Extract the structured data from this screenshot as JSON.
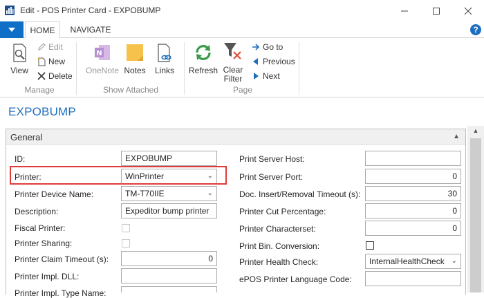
{
  "window": {
    "title": "Edit - POS Printer Card - EXPOBUMP"
  },
  "tabs": {
    "home": "HOME",
    "navigate": "NAVIGATE"
  },
  "ribbon": {
    "view": "View",
    "edit": "Edit",
    "new": "New",
    "delete": "Delete",
    "manage_group": "Manage",
    "onenote": "OneNote",
    "notes": "Notes",
    "links": "Links",
    "show_attached_group": "Show Attached",
    "refresh": "Refresh",
    "clear_filter": "Clear Filter",
    "goto": "Go to",
    "previous": "Previous",
    "next": "Next",
    "page_group": "Page"
  },
  "page": {
    "title": "EXPOBUMP",
    "section": "General"
  },
  "fields_left": {
    "id_label": "ID:",
    "id_value": "EXPOBUMP",
    "printer_label": "Printer:",
    "printer_value": "WinPrinter",
    "device_label": "Printer Device Name:",
    "device_value": "TM-T70IIE",
    "desc_label": "Description:",
    "desc_value": "Expeditor bump printer",
    "fiscal_label": "Fiscal Printer:",
    "sharing_label": "Printer Sharing:",
    "claim_label": "Printer Claim Timeout (s):",
    "claim_value": "0",
    "impl_dll_label": "Printer Impl. DLL:",
    "impl_type_label": "Printer Impl. Type Name:"
  },
  "fields_right": {
    "host_label": "Print Server Host:",
    "port_label": "Print Server Port:",
    "port_value": "0",
    "doc_timeout_label": "Doc. Insert/Removal Timeout (s):",
    "doc_timeout_value": "30",
    "cut_label": "Printer Cut Percentage:",
    "cut_value": "0",
    "charset_label": "Printer Characterset:",
    "charset_value": "0",
    "bin_label": "Print Bin. Conversion:",
    "health_label": "Printer Health Check:",
    "health_value": "InternalHealthCheck",
    "epos_label": "ePOS Printer Language Code:"
  },
  "colors": {
    "accent": "#1f6fbf",
    "highlight": "#e03a3a"
  }
}
